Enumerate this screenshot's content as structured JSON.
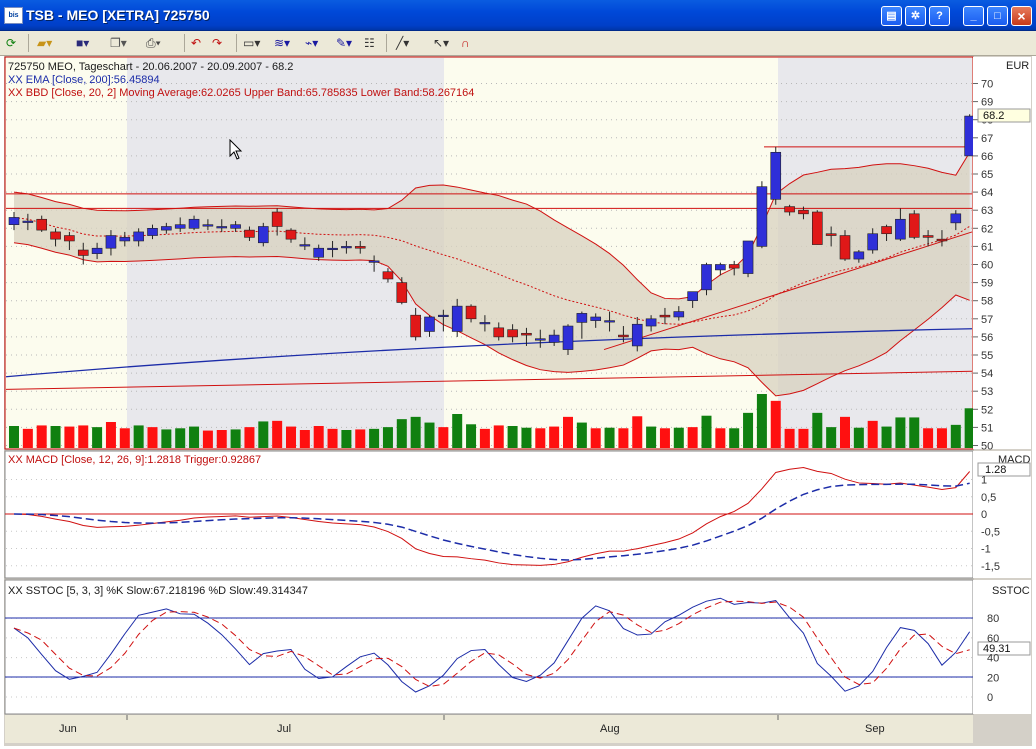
{
  "window": {
    "title": "TSB - MEO [XETRA] 725750",
    "app_icon_text": "bis"
  },
  "toolbar": {
    "icons": [
      "refresh-icon",
      "open-icon",
      "save-icon",
      "copy-icon",
      "print-icon",
      "back-icon",
      "forward-icon",
      "chart-type-icon",
      "indicator-icon",
      "signal-icon",
      "drawing-icon",
      "properties-icon",
      "line-tool-icon",
      "pointer-icon",
      "magnet-icon"
    ]
  },
  "colors": {
    "up_candle": "#2f2fd8",
    "down_candle": "#e01818",
    "volume_up": "#108010",
    "volume_down": "#ff1010",
    "band_fill": "#d8d2bf",
    "sma": "#d01010",
    "ema": "#1c2ca8",
    "shade": "#c0c0c0",
    "panel_bg": "#fcfcee",
    "alt_bg": "#e8e8ec"
  },
  "price_panel": {
    "header": "725750 MEO, Tageschart - 20.06.2007 - 20.09.2007 - 68.2",
    "ema_label": "XX EMA [Close, 200]:56.45894",
    "bbd_label": "XX BBD [Close, 20, 2] Moving Average:62.0265 Upper Band:65.785835 Lower Band:58.267164",
    "currency": "EUR",
    "last_price": "68.2",
    "y_ticks": [
      "70",
      "69",
      "68",
      "67",
      "66",
      "65",
      "64",
      "63",
      "62",
      "61",
      "60",
      "59",
      "58",
      "57",
      "56",
      "55",
      "54",
      "53",
      "52",
      "51",
      "50"
    ]
  },
  "macd_panel": {
    "label": "XX MACD [Close, 12, 26, 9]:1.2818 Trigger:0.92867",
    "title": "MACD",
    "last_value": "1.28",
    "y_ticks": [
      "1",
      "0,5",
      "0",
      "-0,5",
      "-1",
      "-1,5"
    ]
  },
  "sstoc_panel": {
    "label": "XX SSTOC [5, 3, 3] %K Slow:67.218196 %D Slow:49.314347",
    "title": "SSTOC",
    "last_value": "49.31",
    "y_ticks": [
      "80",
      "60",
      "40",
      "20",
      "0"
    ]
  },
  "x_axis": {
    "months": [
      "Jun",
      "Jul",
      "Aug",
      "Sep"
    ]
  },
  "chart_data": {
    "type": "candlestick",
    "candles": [
      {
        "o": 62.2,
        "h": 62.9,
        "l": 61.9,
        "c": 62.6
      },
      {
        "o": 62.4,
        "h": 62.8,
        "l": 61.9,
        "c": 62.4
      },
      {
        "o": 62.5,
        "h": 62.7,
        "l": 61.8,
        "c": 61.9
      },
      {
        "o": 61.8,
        "h": 62.0,
        "l": 61.0,
        "c": 61.4
      },
      {
        "o": 61.6,
        "h": 61.8,
        "l": 60.8,
        "c": 61.3
      },
      {
        "o": 60.8,
        "h": 61.2,
        "l": 60.0,
        "c": 60.5
      },
      {
        "o": 60.6,
        "h": 61.2,
        "l": 60.3,
        "c": 60.9
      },
      {
        "o": 60.9,
        "h": 61.9,
        "l": 60.5,
        "c": 61.6
      },
      {
        "o": 61.3,
        "h": 61.8,
        "l": 61.0,
        "c": 61.5
      },
      {
        "o": 61.3,
        "h": 62.0,
        "l": 61.0,
        "c": 61.8
      },
      {
        "o": 61.6,
        "h": 62.2,
        "l": 61.4,
        "c": 62.0
      },
      {
        "o": 61.9,
        "h": 62.3,
        "l": 61.7,
        "c": 62.1
      },
      {
        "o": 62.0,
        "h": 62.6,
        "l": 61.8,
        "c": 62.2
      },
      {
        "o": 62.0,
        "h": 62.7,
        "l": 61.9,
        "c": 62.5
      },
      {
        "o": 62.2,
        "h": 62.5,
        "l": 61.9,
        "c": 62.2
      },
      {
        "o": 62.1,
        "h": 62.5,
        "l": 61.8,
        "c": 62.1
      },
      {
        "o": 62.0,
        "h": 62.4,
        "l": 61.8,
        "c": 62.2
      },
      {
        "o": 61.9,
        "h": 62.1,
        "l": 61.3,
        "c": 61.5
      },
      {
        "o": 61.2,
        "h": 62.3,
        "l": 61.0,
        "c": 62.1
      },
      {
        "o": 62.9,
        "h": 63.1,
        "l": 61.6,
        "c": 62.1
      },
      {
        "o": 61.9,
        "h": 62.0,
        "l": 61.2,
        "c": 61.4
      },
      {
        "o": 61.1,
        "h": 61.5,
        "l": 60.8,
        "c": 61.1
      },
      {
        "o": 60.4,
        "h": 61.1,
        "l": 60.2,
        "c": 60.9
      },
      {
        "o": 60.9,
        "h": 61.3,
        "l": 60.4,
        "c": 60.9
      },
      {
        "o": 61.0,
        "h": 61.3,
        "l": 60.6,
        "c": 61.0
      },
      {
        "o": 61.0,
        "h": 61.3,
        "l": 60.6,
        "c": 60.9
      },
      {
        "o": 60.2,
        "h": 60.5,
        "l": 59.6,
        "c": 60.2
      },
      {
        "o": 59.6,
        "h": 59.8,
        "l": 59.0,
        "c": 59.2
      },
      {
        "o": 59.0,
        "h": 59.3,
        "l": 57.8,
        "c": 57.9
      },
      {
        "o": 57.2,
        "h": 57.6,
        "l": 55.8,
        "c": 56.0
      },
      {
        "o": 56.3,
        "h": 57.2,
        "l": 56.0,
        "c": 57.1
      },
      {
        "o": 57.2,
        "h": 57.5,
        "l": 56.3,
        "c": 57.2
      },
      {
        "o": 56.3,
        "h": 58.1,
        "l": 56.0,
        "c": 57.7
      },
      {
        "o": 57.7,
        "h": 57.8,
        "l": 56.8,
        "c": 57.0
      },
      {
        "o": 56.8,
        "h": 57.2,
        "l": 56.3,
        "c": 56.8
      },
      {
        "o": 56.5,
        "h": 56.8,
        "l": 55.8,
        "c": 56.0
      },
      {
        "o": 56.4,
        "h": 56.7,
        "l": 55.7,
        "c": 56.0
      },
      {
        "o": 56.2,
        "h": 56.5,
        "l": 55.5,
        "c": 56.1
      },
      {
        "o": 55.9,
        "h": 56.4,
        "l": 55.4,
        "c": 55.9
      },
      {
        "o": 55.7,
        "h": 56.4,
        "l": 55.5,
        "c": 56.1
      },
      {
        "o": 55.3,
        "h": 56.7,
        "l": 55.0,
        "c": 56.6
      },
      {
        "o": 56.8,
        "h": 57.4,
        "l": 55.9,
        "c": 57.3
      },
      {
        "o": 56.9,
        "h": 57.3,
        "l": 56.5,
        "c": 57.1
      },
      {
        "o": 56.9,
        "h": 57.4,
        "l": 56.3,
        "c": 56.9
      },
      {
        "o": 56.1,
        "h": 56.6,
        "l": 55.7,
        "c": 56.0
      },
      {
        "o": 55.5,
        "h": 57.1,
        "l": 55.2,
        "c": 56.7
      },
      {
        "o": 56.6,
        "h": 57.2,
        "l": 56.3,
        "c": 57.0
      },
      {
        "o": 57.2,
        "h": 57.6,
        "l": 56.7,
        "c": 57.1
      },
      {
        "o": 57.1,
        "h": 57.7,
        "l": 56.9,
        "c": 57.4
      },
      {
        "o": 58.0,
        "h": 58.3,
        "l": 57.6,
        "c": 58.5
      },
      {
        "o": 58.6,
        "h": 60.1,
        "l": 58.3,
        "c": 60.0
      },
      {
        "o": 59.7,
        "h": 60.1,
        "l": 59.4,
        "c": 60.0
      },
      {
        "o": 60.0,
        "h": 60.2,
        "l": 59.4,
        "c": 59.8
      },
      {
        "o": 59.5,
        "h": 61.2,
        "l": 59.3,
        "c": 61.3
      },
      {
        "o": 61.0,
        "h": 64.6,
        "l": 60.9,
        "c": 64.3
      },
      {
        "o": 63.6,
        "h": 66.5,
        "l": 63.3,
        "c": 66.2
      },
      {
        "o": 63.2,
        "h": 63.3,
        "l": 62.7,
        "c": 62.9
      },
      {
        "o": 63.0,
        "h": 63.2,
        "l": 62.5,
        "c": 62.8
      },
      {
        "o": 62.9,
        "h": 63.0,
        "l": 61.1,
        "c": 61.1
      },
      {
        "o": 61.7,
        "h": 62.1,
        "l": 61.0,
        "c": 61.6
      },
      {
        "o": 61.6,
        "h": 61.9,
        "l": 60.2,
        "c": 60.3
      },
      {
        "o": 60.3,
        "h": 60.8,
        "l": 60.1,
        "c": 60.7
      },
      {
        "o": 60.8,
        "h": 62.0,
        "l": 60.6,
        "c": 61.7
      },
      {
        "o": 62.1,
        "h": 62.2,
        "l": 61.3,
        "c": 61.7
      },
      {
        "o": 61.4,
        "h": 63.1,
        "l": 61.3,
        "c": 62.5
      },
      {
        "o": 62.8,
        "h": 63.0,
        "l": 61.4,
        "c": 61.5
      },
      {
        "o": 61.6,
        "h": 61.9,
        "l": 61.0,
        "c": 61.5
      },
      {
        "o": 61.4,
        "h": 61.9,
        "l": 61.0,
        "c": 61.3
      },
      {
        "o": 62.3,
        "h": 63.0,
        "l": 61.9,
        "c": 62.8
      },
      {
        "o": 66.0,
        "h": 68.3,
        "l": 66.0,
        "c": 68.2
      }
    ],
    "volume_up": [
      true,
      false,
      false,
      true,
      false,
      false,
      true,
      false,
      false,
      true,
      false,
      true,
      true,
      true,
      false,
      false,
      true,
      false,
      true,
      false,
      false,
      false,
      false,
      false,
      true,
      false,
      true,
      true,
      true,
      true,
      true,
      false,
      true,
      true,
      false,
      false,
      true,
      true,
      false,
      false,
      false,
      true,
      false,
      true,
      false,
      false,
      true,
      false,
      true,
      false,
      true,
      false,
      true,
      true,
      true,
      false,
      false,
      false,
      true,
      true,
      false,
      true,
      false,
      true,
      true,
      true,
      false,
      false,
      true,
      true
    ]
  }
}
